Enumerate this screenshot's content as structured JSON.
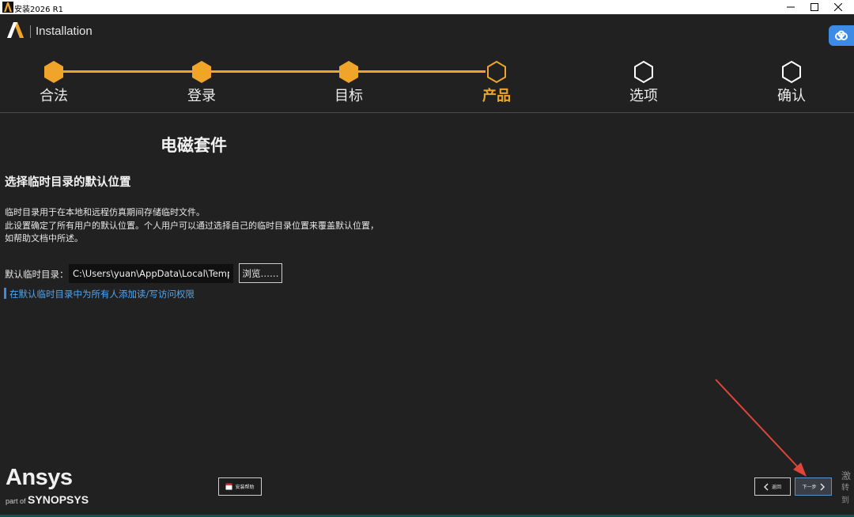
{
  "window": {
    "title": "安装2026 R1"
  },
  "header": {
    "brand_text": "Installation"
  },
  "stepper": {
    "steps": [
      {
        "label": "合法",
        "state": "done"
      },
      {
        "label": "登录",
        "state": "done"
      },
      {
        "label": "目标",
        "state": "done"
      },
      {
        "label": "产品",
        "state": "current"
      },
      {
        "label": "选项",
        "state": "pending"
      },
      {
        "label": "确认",
        "state": "pending"
      }
    ]
  },
  "content": {
    "section_title": "电磁套件",
    "heading": "选择临时目录的默认位置",
    "desc_line1": "临时目录用于在本地和远程仿真期间存储临时文件。",
    "desc_line2": "此设置确定了所有用户的默认位置。个人用户可以通过选择自己的临时目录位置来覆盖默认位置，",
    "desc_line3": "如帮助文档中所述。",
    "dir_label": "默认临时目录：",
    "dir_value": "C:\\Users\\yuan\\AppData\\Local\\Temp",
    "browse_label": "浏览……",
    "permission_link": "在默认临时目录中为所有人添加读/写访问权限"
  },
  "footer": {
    "logo_word": "Ansys",
    "logo_part_of": "part of",
    "logo_company": "SYNOPSYS",
    "help_label": "安装帮助",
    "back_label": "返回",
    "next_label": "下一步"
  },
  "overlay": {
    "watermark_line1": "激",
    "watermark_line2": "转到"
  },
  "colors": {
    "accent": "#f0a52a",
    "background": "#212121",
    "link": "#4ea6f4",
    "annotation_arrow": "#e0453a"
  }
}
